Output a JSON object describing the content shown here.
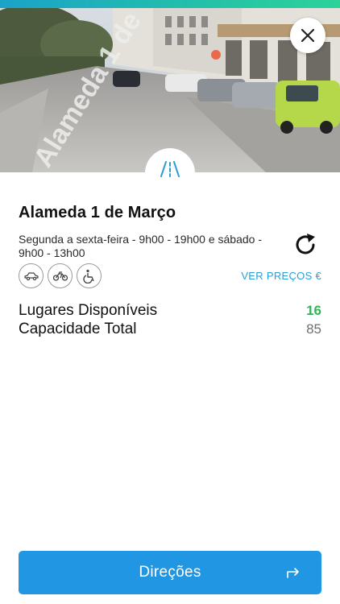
{
  "colors": {
    "accent_teal": "#24c1a8",
    "link_blue": "#2a9fd6",
    "button_blue": "#2196e3",
    "available_green": "#34b35a"
  },
  "photo": {
    "icons": {
      "close": "close-icon",
      "road": "road-icon"
    }
  },
  "parking": {
    "name": "Alameda 1 de Março",
    "hours": "Segunda a sexta-feira - 9h00 - 19h00 e sábado - 9h00 - 13h00",
    "vehicle_icons": [
      "car-icon",
      "motorcycle-icon",
      "wheelchair-icon"
    ],
    "refresh_icon": "refresh-icon",
    "prices_link": "VER PREÇOS €",
    "available_label": "Lugares Disponíveis",
    "available_value": "16",
    "total_label": "Capacidade Total",
    "total_value": "85"
  },
  "footer": {
    "directions_label": "Direções",
    "directions_icon": "arrow-turn-right-icon"
  }
}
